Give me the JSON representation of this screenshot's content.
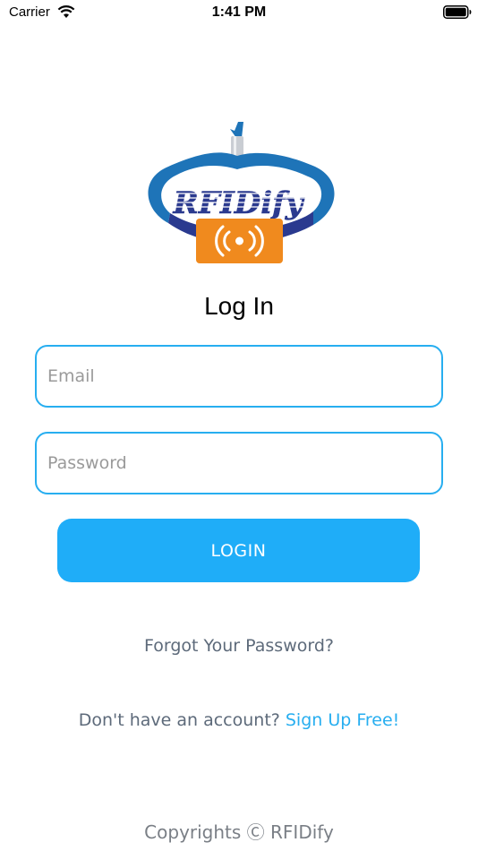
{
  "status_bar": {
    "carrier": "Carrier",
    "time": "1:41 PM",
    "icons": [
      "wifi-icon",
      "battery-icon"
    ]
  },
  "logo": {
    "text": "RFIDify",
    "colors": {
      "band": "#1e74b8",
      "band_dark": "#2a3a8f",
      "tag": "#f08a1e",
      "text": "#2b3a8f"
    }
  },
  "login": {
    "title": "Log In",
    "email_placeholder": "Email",
    "password_placeholder": "Password",
    "button_label": "LOGIN"
  },
  "links": {
    "forgot_password": "Forgot Your Password?",
    "no_account_text": "Don't have an account?",
    "signup": "Sign Up Free!"
  },
  "footer": {
    "copyright": "Copyrights Ⓒ RFIDify"
  },
  "colors": {
    "accent": "#27aef0",
    "button": "#1fadf8",
    "muted_text": "#5d6a7a"
  }
}
